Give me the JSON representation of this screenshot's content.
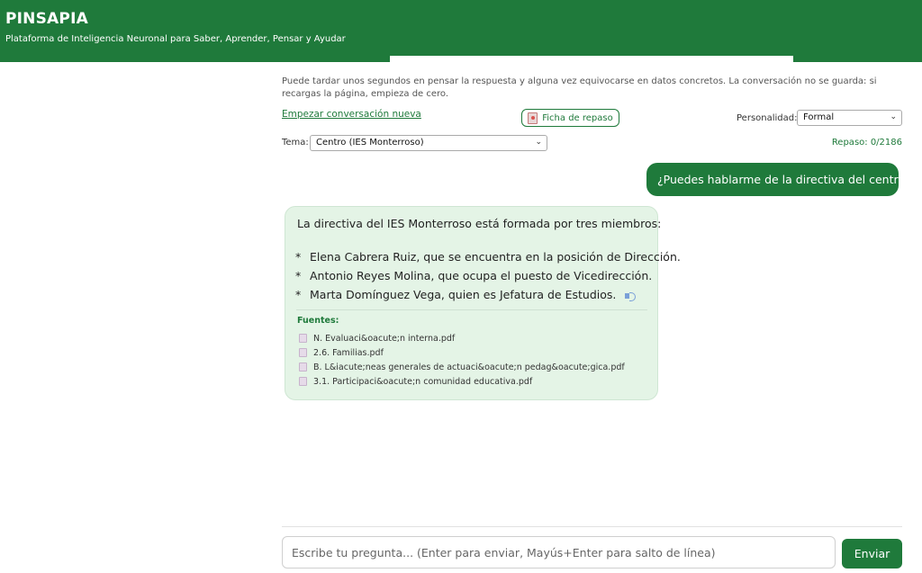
{
  "header": {
    "brand": "PINSAPIA",
    "tagline": "Plataforma de Inteligencia Neuronal para Saber, Aprender, Pensar y Ayudar"
  },
  "notice": "Puede tardar unos segundos en pensar la respuesta y alguna vez equivocarse en datos concretos. La conversación no se guarda: si recargas la página, empieza de cero.",
  "controls": {
    "new_conversation": "Empezar conversación nueva",
    "ficha_button": "Ficha de repaso",
    "personalidad_label": "Personalidad:",
    "personalidad_value": "Formal",
    "tema_label": "Tema:",
    "tema_value": "Centro (IES Monterroso)",
    "repaso": "Repaso: 0/2186"
  },
  "messages": {
    "user": "¿Puedes hablarme de la directiva del centro?",
    "bot": {
      "intro": "La directiva del IES Monterroso está formada por tres miembros:",
      "bullet": "*",
      "items": [
        "Elena Cabrera Ruiz, que se encuentra en la posición de Dirección.",
        "Antonio Reyes Molina, que ocupa el puesto de Vicedirección.",
        "Marta Domínguez Vega, quien es Jefatura de Estudios."
      ],
      "sources_title": "Fuentes:",
      "sources": [
        "N. Evaluaci&oacute;n interna.pdf",
        "2.6. Familias.pdf",
        "B. L&iacute;neas generales de actuaci&oacute;n pedag&oacute;gica.pdf",
        "3.1. Participaci&oacute;n comunidad educativa.pdf"
      ]
    }
  },
  "input": {
    "placeholder": "Escribe tu pregunta... (Enter para enviar, Mayús+Enter para salto de línea)",
    "send_label": "Enviar"
  },
  "colors": {
    "brand_green": "#1f7a3b",
    "bot_bubble": "#e4f4e6"
  }
}
